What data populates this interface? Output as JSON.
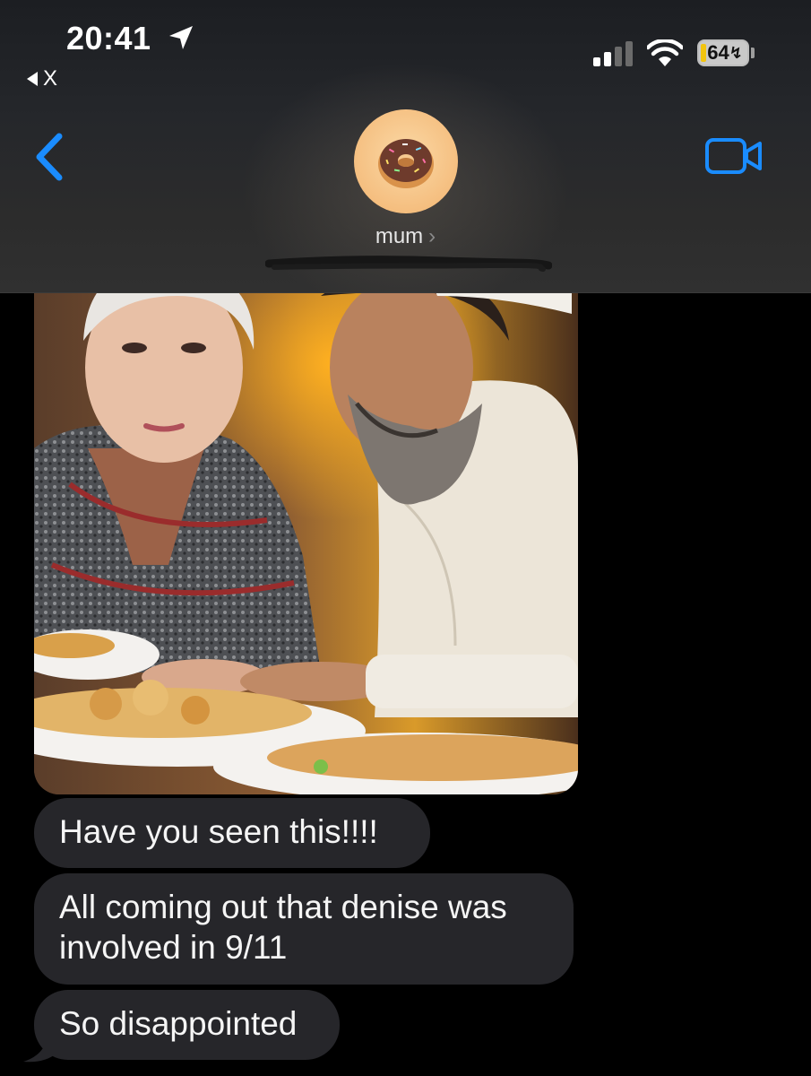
{
  "status_bar": {
    "time": "20:41",
    "back_app": "X",
    "battery": "64",
    "icons": [
      "location-arrow-icon",
      "signal-bars-icon",
      "wifi-icon",
      "battery-icon"
    ]
  },
  "header": {
    "contact_name": "mum",
    "name_chevron": "›",
    "avatar_icon": "donut-emoji",
    "back_icon": "chevron-left-icon",
    "video_icon": "facetime-video-icon",
    "accent_color": "#1a8cff"
  },
  "messages": [
    {
      "type": "image",
      "description_icon": "photo"
    },
    {
      "type": "text",
      "text_lines": [
        "Have you seen this!!!!"
      ]
    },
    {
      "type": "text",
      "text_lines": [
        "All coming out that denise was",
        "involved in 9/11"
      ]
    },
    {
      "type": "text",
      "text_lines": [
        "So disappointed"
      ]
    }
  ],
  "colors": {
    "incoming_bubble": "#26262a",
    "background": "#000000"
  }
}
